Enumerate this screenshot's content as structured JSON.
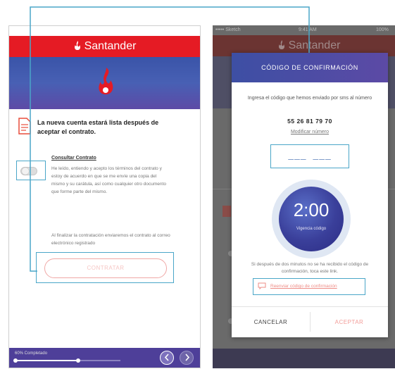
{
  "colors": {
    "brand_red": "#e51b24",
    "accent_purple": "#4e3f99",
    "highlight_blue": "#4aa6c8",
    "link_pink": "#ee8c86"
  },
  "left_phone": {
    "status": {
      "carrier": "••••• Sketch",
      "time": "9:41 AM",
      "battery": "100%"
    },
    "brand": "Santander",
    "message": "La nueva cuenta estará lista después de aceptar el contrato.",
    "consult_link": "Consultar Contrato",
    "terms_text": "He leído, entiendo y acepto los términos del contrato y estoy de acuerdo en que se me envíe una copia del mismo y su carátula, así como cualquier otro documento que forme parte del mismo.",
    "final_note": "Al finalizar la contratación enviaremos el contrato al correo electrónico registrado",
    "contratar_label": "CONTRATAR",
    "progress": {
      "label": "60% Completado",
      "percent": 60
    },
    "icons": {
      "prev": "chevron-left-icon",
      "next": "chevron-right-icon",
      "doc": "document-icon"
    }
  },
  "right_phone": {
    "status": {
      "carrier": "••••• Sketch",
      "time": "9:41 AM",
      "battery": "100%"
    },
    "brand": "Santander"
  },
  "modal": {
    "title": "CÓDIGO DE CONFIRMACIÓN",
    "instructions": "Ingresa el código que hemos enviado por sms al número",
    "phone_number": "55 26 81 79 70",
    "modify_link": "Modificar número",
    "code_placeholder": "___ ___",
    "timer_value": "2:00",
    "timer_label": "Vigencia código",
    "help_text": "Si después de dos minutos no se ha recibido el código de confirmación, toca este link.",
    "resend_link": "Reenviar código de confirmación",
    "cancel_label": "CANCELAR",
    "accept_label": "ACEPTAR"
  }
}
